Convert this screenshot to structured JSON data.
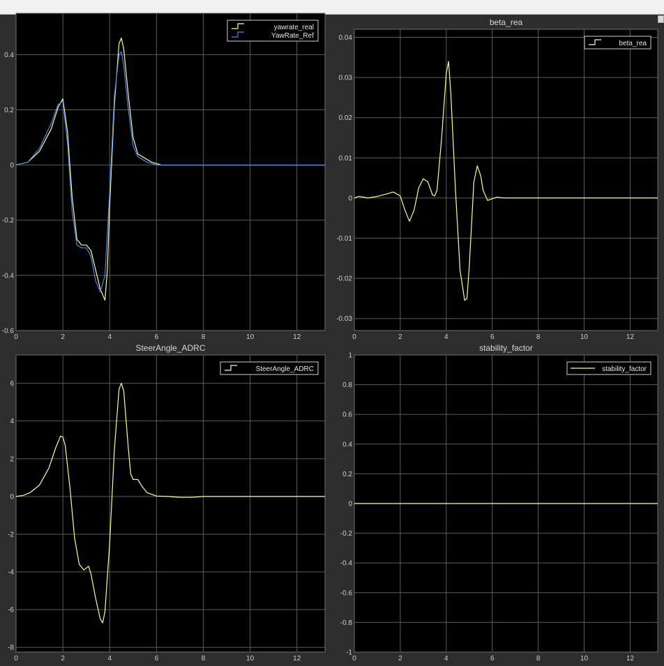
{
  "window": {
    "toolbar": ""
  },
  "colors": {
    "background": "#2d2d2d",
    "axes_bg": "#000000",
    "grid": "#5c5c5c",
    "yellow": "#ffff8c",
    "blue": "#4a86e8"
  },
  "chart_data": [
    {
      "type": "line",
      "title": "",
      "xlim": [
        0,
        13.2
      ],
      "ylim": [
        -0.6,
        0.55
      ],
      "xticks": [
        0,
        2,
        4,
        6,
        8,
        10,
        12
      ],
      "yticks": [
        -0.6,
        -0.4,
        -0.2,
        0,
        0.2,
        0.4
      ],
      "ytick_labels": [
        "-0.6",
        "-0.4",
        "-0.2",
        "0",
        "0.2",
        "0.4"
      ],
      "legend": "top-right",
      "grid": true,
      "series": [
        {
          "name": "yawrate_real",
          "color": "#ffff8c",
          "x": [
            0,
            0.5,
            1.0,
            1.5,
            1.8,
            2.0,
            2.2,
            2.4,
            2.6,
            2.8,
            3.0,
            3.2,
            3.4,
            3.6,
            3.8,
            3.9,
            4.0,
            4.2,
            4.4,
            4.5,
            4.6,
            4.8,
            5.0,
            5.2,
            5.4,
            5.6,
            5.8,
            6.0,
            6.2,
            6.4,
            6.6,
            6.8,
            7.0,
            8,
            9,
            10,
            11,
            12,
            13.2
          ],
          "y": [
            0,
            0.01,
            0.05,
            0.13,
            0.21,
            0.24,
            0.12,
            -0.12,
            -0.27,
            -0.29,
            -0.29,
            -0.31,
            -0.38,
            -0.45,
            -0.49,
            -0.38,
            -0.15,
            0.22,
            0.44,
            0.46,
            0.42,
            0.25,
            0.1,
            0.04,
            0.03,
            0.02,
            0.01,
            0.005,
            0,
            0,
            0,
            0,
            0,
            0,
            0,
            0,
            0,
            0,
            0
          ]
        },
        {
          "name": "YawRate_Ref",
          "color": "#4a86e8",
          "x": [
            0,
            0.5,
            1.0,
            1.5,
            1.8,
            2.0,
            2.2,
            2.4,
            2.6,
            2.8,
            3.0,
            3.2,
            3.4,
            3.6,
            3.8,
            4.0,
            4.2,
            4.4,
            4.5,
            4.6,
            4.8,
            5.0,
            5.2,
            5.4,
            5.6,
            5.8,
            6.0,
            6.2,
            6.4,
            6.6,
            6.8,
            7.0,
            8,
            9,
            10,
            11,
            12,
            13.2
          ],
          "y": [
            0,
            0.01,
            0.06,
            0.15,
            0.22,
            0.23,
            0.08,
            -0.17,
            -0.29,
            -0.3,
            -0.3,
            -0.33,
            -0.42,
            -0.46,
            -0.4,
            -0.1,
            0.25,
            0.4,
            0.41,
            0.36,
            0.2,
            0.07,
            0.03,
            0.02,
            0.01,
            0.005,
            0,
            0,
            0,
            0,
            0,
            0,
            0,
            0,
            0,
            0,
            0,
            0
          ]
        }
      ]
    },
    {
      "type": "line",
      "title": "beta_rea",
      "xlim": [
        0,
        13.2
      ],
      "ylim": [
        -0.033,
        0.042
      ],
      "xticks": [
        0,
        2,
        4,
        6,
        8,
        10,
        12
      ],
      "yticks": [
        -0.03,
        -0.02,
        -0.01,
        0,
        0.01,
        0.02,
        0.03,
        0.04
      ],
      "ytick_labels": [
        "-0.03",
        "-0.02",
        "-0.01",
        "0",
        "0.01",
        "0.02",
        "0.03",
        "0.04"
      ],
      "legend": "top-right",
      "grid": true,
      "series": [
        {
          "name": "beta_rea",
          "color": "#ffff8c",
          "x": [
            0,
            0.2,
            0.6,
            1.0,
            1.4,
            1.7,
            2.0,
            2.2,
            2.4,
            2.6,
            2.8,
            3.0,
            3.2,
            3.4,
            3.5,
            3.6,
            3.8,
            4.0,
            4.1,
            4.2,
            4.4,
            4.6,
            4.8,
            4.9,
            5.0,
            5.2,
            5.35,
            5.5,
            5.6,
            5.8,
            6.0,
            6.2,
            6.5,
            7,
            8,
            9,
            10,
            11,
            12,
            13.2
          ],
          "y": [
            0,
            0.0004,
            0,
            0.0004,
            0.001,
            0.0015,
            0.0005,
            -0.003,
            -0.0058,
            -0.003,
            0.0025,
            0.0048,
            0.004,
            0.0008,
            0.0005,
            0.002,
            0.015,
            0.031,
            0.034,
            0.026,
            0.002,
            -0.018,
            -0.0255,
            -0.025,
            -0.017,
            0.004,
            0.008,
            0.0055,
            0.002,
            -0.0006,
            -0.0002,
            0.0002,
            0,
            0,
            0,
            0,
            0,
            0,
            0,
            0
          ]
        }
      ]
    },
    {
      "type": "line",
      "title": "SteerAngle_ADRC",
      "xlim": [
        0,
        13.2
      ],
      "ylim": [
        -8.25,
        7.5
      ],
      "xticks": [
        0,
        2,
        4,
        6,
        8,
        10,
        12
      ],
      "yticks": [
        -8,
        -6,
        -4,
        -2,
        0,
        2,
        4,
        6
      ],
      "ytick_labels": [
        "-8",
        "-6",
        "-4",
        "-2",
        "0",
        "2",
        "4",
        "6"
      ],
      "legend": "top-right",
      "grid": true,
      "series": [
        {
          "name": "SteerAngle_ADRC",
          "color": "#ffff8c",
          "x": [
            0,
            0.3,
            0.6,
            1.0,
            1.4,
            1.7,
            1.9,
            2.0,
            2.1,
            2.3,
            2.5,
            2.7,
            2.9,
            3.1,
            3.2,
            3.4,
            3.6,
            3.7,
            3.8,
            4.0,
            4.2,
            4.4,
            4.5,
            4.6,
            4.8,
            4.9,
            5.0,
            5.2,
            5.4,
            5.6,
            6.0,
            6.5,
            7.0,
            7.5,
            8,
            9,
            10,
            11,
            12,
            13.2
          ],
          "y": [
            0,
            0.05,
            0.2,
            0.6,
            1.5,
            2.6,
            3.2,
            3.15,
            2.7,
            0.5,
            -2.2,
            -3.6,
            -3.9,
            -3.7,
            -4.1,
            -5.4,
            -6.5,
            -6.7,
            -6.1,
            -2.5,
            2.5,
            5.7,
            6.0,
            5.6,
            2.5,
            1.2,
            0.9,
            0.9,
            0.5,
            0.2,
            0.02,
            0,
            -0.05,
            -0.05,
            0,
            0,
            0,
            0,
            0,
            0
          ]
        }
      ]
    },
    {
      "type": "line",
      "title": "stability_factor",
      "xlim": [
        0,
        13.2
      ],
      "ylim": [
        -1,
        1
      ],
      "xticks": [
        0,
        2,
        4,
        6,
        8,
        10,
        12
      ],
      "yticks": [
        -1,
        -0.8,
        -0.6,
        -0.4,
        -0.2,
        0,
        0.2,
        0.4,
        0.6,
        0.8,
        1
      ],
      "ytick_labels": [
        "-1",
        "-0.8",
        "-0.6",
        "-0.4",
        "-0.2",
        "0",
        "0.2",
        "0.4",
        "0.6",
        "0.8",
        "1"
      ],
      "legend": "top-right",
      "grid": true,
      "series": [
        {
          "name": "stability_factor",
          "color": "#ffff8c",
          "style": "solid",
          "x": [
            0,
            13.2
          ],
          "y": [
            0,
            0
          ]
        }
      ]
    }
  ]
}
